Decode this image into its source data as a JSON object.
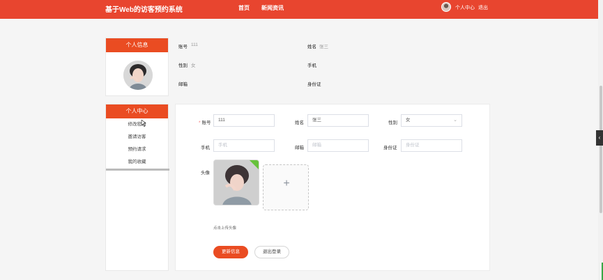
{
  "header": {
    "title": "基于Web的访客预约系统",
    "nav": [
      "首页",
      "新闻资讯"
    ],
    "user_center": "个人中心",
    "logout": "退出"
  },
  "profile_card": {
    "title": "个人信息"
  },
  "profile_info": {
    "account_label": "账号",
    "account_value": "111",
    "name_label": "姓名",
    "name_value": "张三",
    "gender_label": "性别",
    "gender_value": "女",
    "phone_label": "手机",
    "email_label": "邮箱",
    "id_label": "身份证"
  },
  "sidebar": {
    "title": "个人中心",
    "items": [
      "修改密码",
      "邀请访客",
      "预约请求",
      "我的收藏"
    ]
  },
  "form": {
    "account_label": "账号",
    "account_value": "111",
    "name_label": "姓名",
    "name_value": "张三",
    "gender_label": "性别",
    "gender_value": "女",
    "phone_label": "手机",
    "phone_placeholder": "手机",
    "email_label": "邮箱",
    "email_placeholder": "邮箱",
    "id_label": "身份证",
    "id_placeholder": "身份证",
    "avatar_label": "头像",
    "upload_hint": "点击上传头像",
    "update_button": "更新信息",
    "logout_button": "退出登录"
  },
  "icons": {
    "top_avatar": "avatar-icon",
    "upload": "plus-icon",
    "select_arrow": "chevron-down-icon",
    "side_toggle": "chevron-left-icon"
  },
  "colors": {
    "header": "#e8452f",
    "accent": "#ea4c22"
  }
}
